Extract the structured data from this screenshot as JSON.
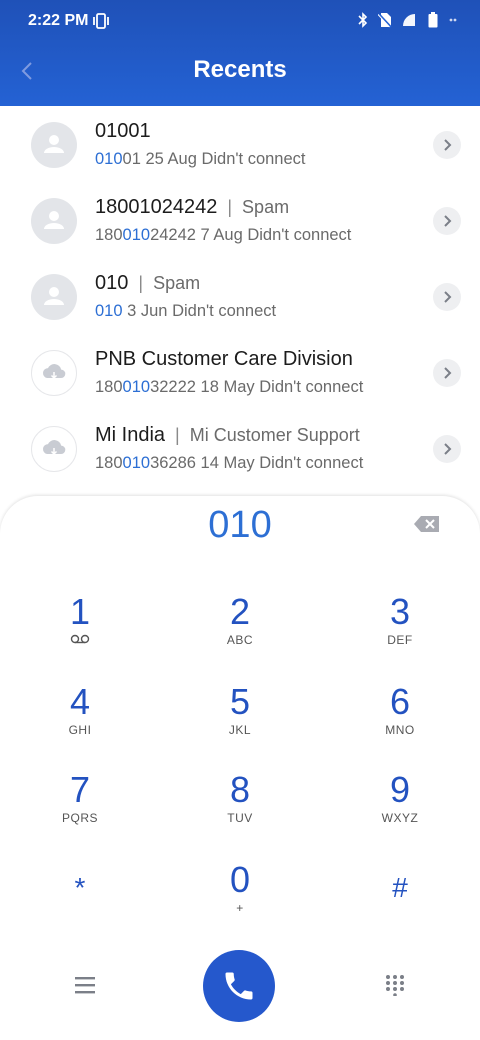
{
  "status_bar": {
    "time": "2:22 PM"
  },
  "header": {
    "title": "Recents"
  },
  "recents": [
    {
      "name": "01001",
      "tag": "",
      "number_pre": "",
      "number_match": "010",
      "number_post": "01",
      "detail": "25 Aug Didn't connect",
      "avatar": "person-icon"
    },
    {
      "name": "18001024242",
      "tag": "Spam",
      "number_pre": "180",
      "number_match": "010",
      "number_post": "24242",
      "detail": "7 Aug Didn't connect",
      "avatar": "person-icon"
    },
    {
      "name": "010",
      "tag": "Spam",
      "number_pre": "",
      "number_match": "010",
      "number_post": "",
      "detail": "3 Jun Didn't connect",
      "avatar": "person-icon"
    },
    {
      "name": "PNB Customer Care Division",
      "tag": "",
      "number_pre": "180",
      "number_match": "010",
      "number_post": "32222",
      "detail": "18 May Didn't connect",
      "avatar": "cloud-icon"
    },
    {
      "name": "Mi India",
      "tag": "Mi Customer Support",
      "number_pre": "180",
      "number_match": "010",
      "number_post": "36286",
      "detail": "14 May Didn't connect",
      "avatar": "cloud-icon"
    }
  ],
  "dialer": {
    "entered_number": "010",
    "keys": [
      {
        "digit": "1",
        "letters": ""
      },
      {
        "digit": "2",
        "letters": "ABC"
      },
      {
        "digit": "3",
        "letters": "DEF"
      },
      {
        "digit": "4",
        "letters": "GHI"
      },
      {
        "digit": "5",
        "letters": "JKL"
      },
      {
        "digit": "6",
        "letters": "MNO"
      },
      {
        "digit": "7",
        "letters": "PQRS"
      },
      {
        "digit": "8",
        "letters": "TUV"
      },
      {
        "digit": "9",
        "letters": "WXYZ"
      },
      {
        "digit": "*",
        "letters": ""
      },
      {
        "digit": "0",
        "letters": "+"
      },
      {
        "digit": "#",
        "letters": ""
      }
    ]
  },
  "colors": {
    "header_blue": "#2462d4",
    "accent_blue": "#2d6fd4",
    "call_button": "#2558cc"
  }
}
